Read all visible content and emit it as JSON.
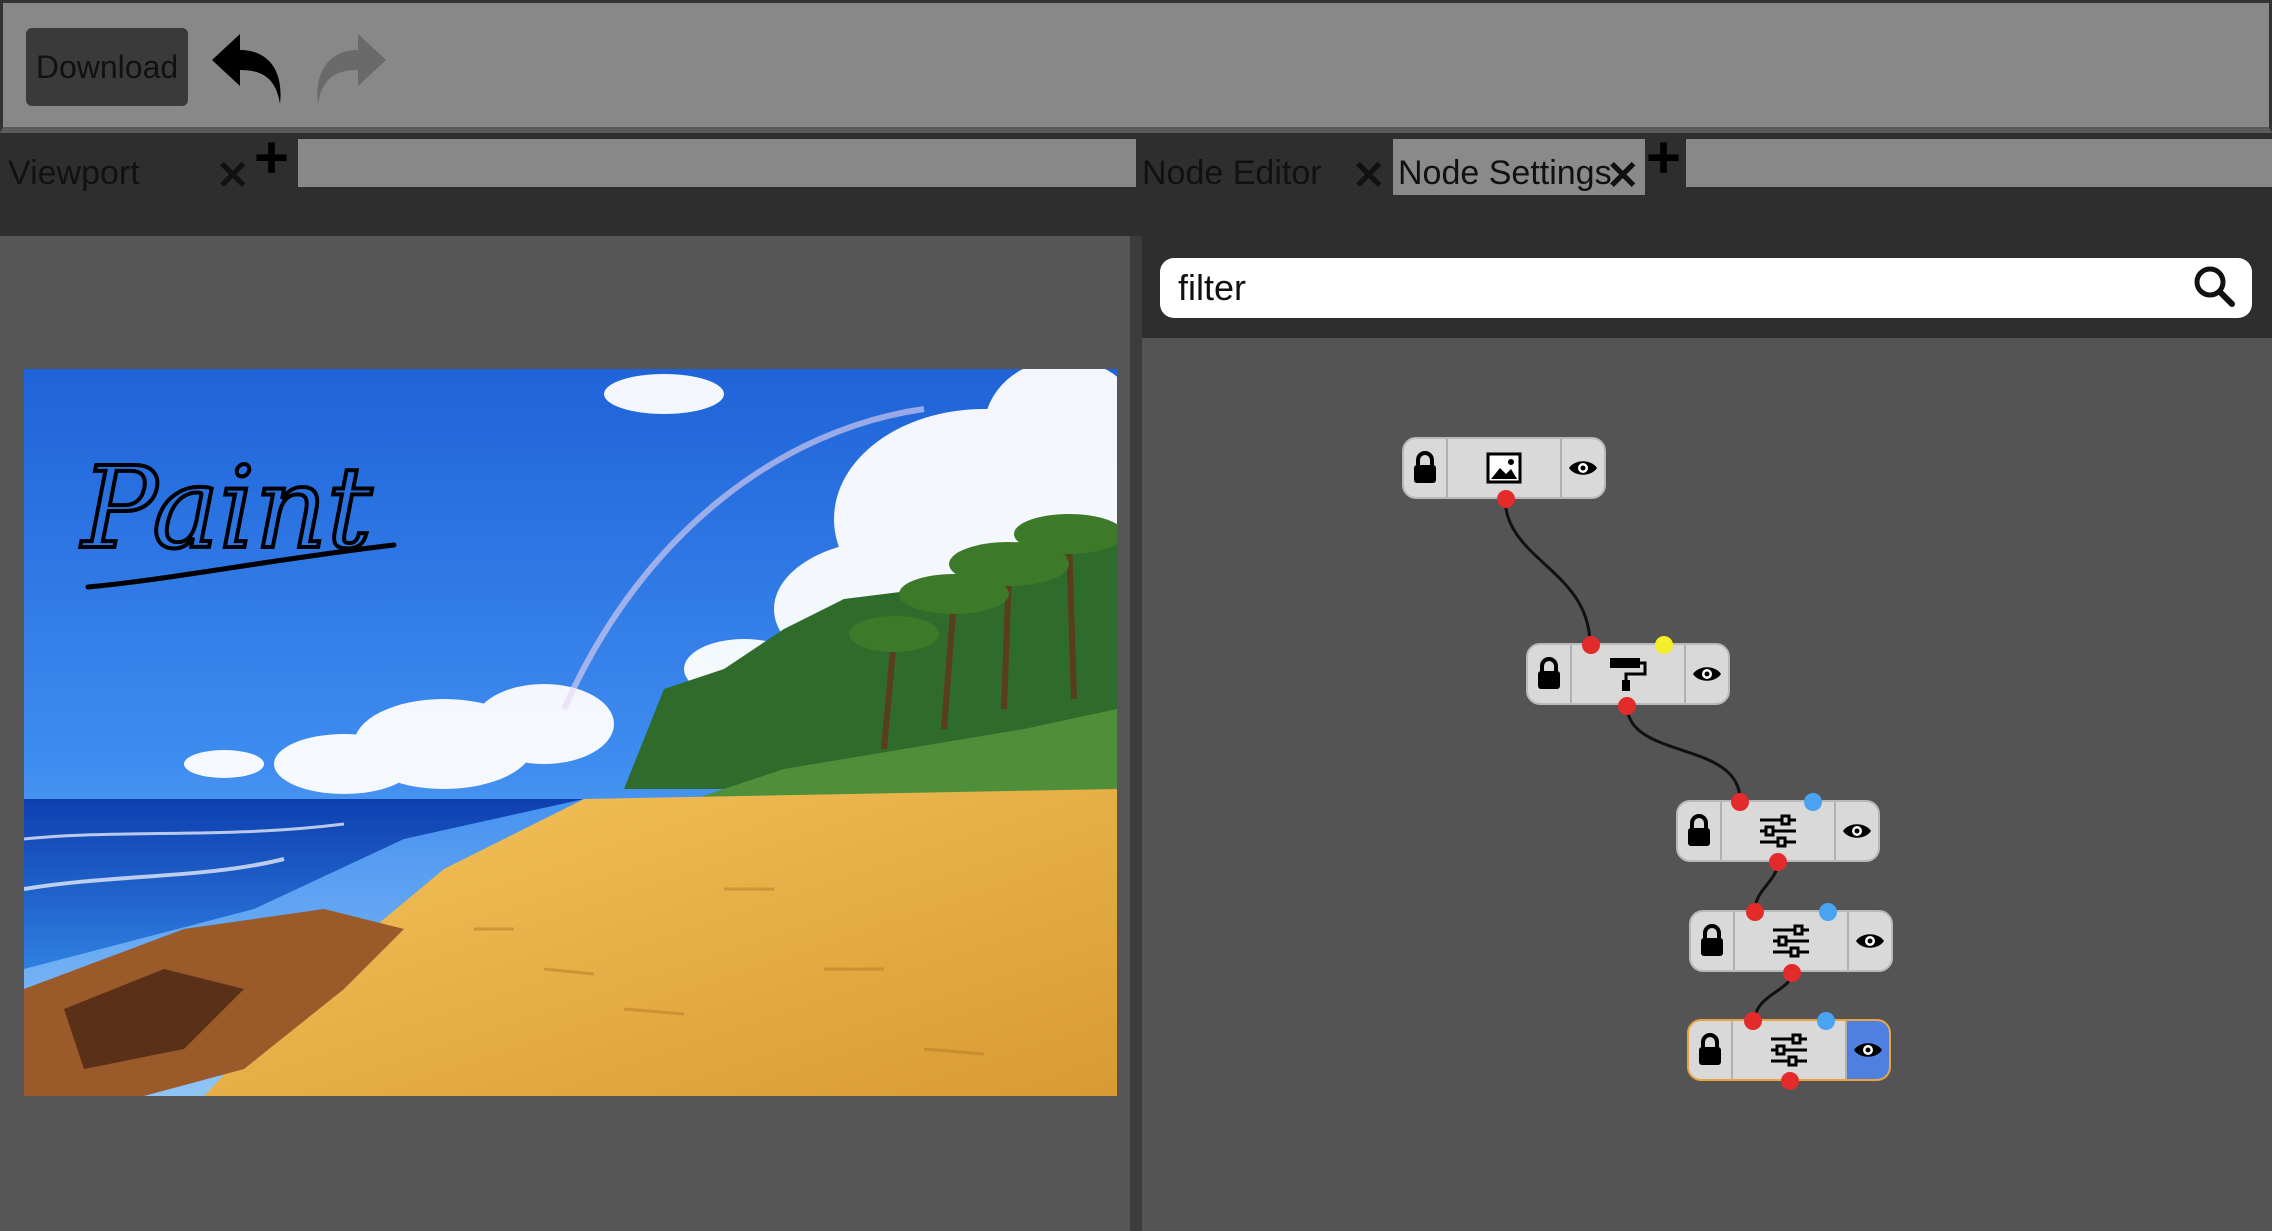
{
  "toolbar": {
    "download_label": "Download",
    "undo_icon": "undo-arrow-icon",
    "redo_icon": "redo-arrow-icon"
  },
  "tabs": {
    "left": [
      {
        "label": "Viewport",
        "close": "✕"
      }
    ],
    "right": [
      {
        "label": "Node Editor",
        "close": "✕"
      },
      {
        "label": "Node Settings",
        "close": "✕"
      }
    ],
    "add": "+"
  },
  "search": {
    "value": "filter",
    "icon": "magnifier-icon"
  },
  "viewport": {
    "overlay_text": "Paint",
    "image": "beach-with-palm-trees-and-rainbow"
  },
  "nodes": [
    {
      "type": "image",
      "icon": "image-icon"
    },
    {
      "type": "paint",
      "icon": "paint-roller-icon"
    },
    {
      "type": "adjust",
      "icon": "sliders-icon"
    },
    {
      "type": "adjust",
      "icon": "sliders-icon"
    },
    {
      "type": "adjust",
      "icon": "sliders-icon",
      "selected": true
    }
  ],
  "colors": {
    "toolbar": "#888888",
    "panel": "#545454",
    "port_red": "#e32b2b",
    "port_yellow": "#f4ef2a",
    "port_blue": "#4aa3f0",
    "selected_border": "#e9a440",
    "selected_eye": "#4f7fe0"
  }
}
